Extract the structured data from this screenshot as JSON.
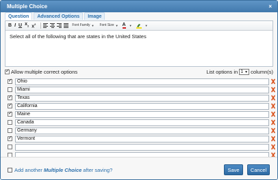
{
  "dialog": {
    "title": "Multiple Choice",
    "close_glyph": "×"
  },
  "tabs": [
    {
      "label": "Question",
      "active": true
    },
    {
      "label": "Advanced Options",
      "active": false
    },
    {
      "label": "Image",
      "active": false
    }
  ],
  "toolbar": {
    "bold": "B",
    "italic": "I",
    "underline": "U",
    "subscript": "x",
    "superscript": "x",
    "font_family": "Font Family",
    "font_size": "Font Size",
    "text_color_glyph": "A"
  },
  "editor": {
    "question_text": "Select all of the following that are states in the United States"
  },
  "options": {
    "allow_multiple_label": "Allow multiple correct options",
    "allow_multiple_checked": true,
    "list_options_prefix": "List options in",
    "columns_value": "1",
    "columns_suffix": "column(s)"
  },
  "choices": [
    {
      "text": "Ohio",
      "correct": true
    },
    {
      "text": "Miami",
      "correct": false
    },
    {
      "text": "Texas",
      "correct": true
    },
    {
      "text": "California",
      "correct": true
    },
    {
      "text": "Maine",
      "correct": true
    },
    {
      "text": "Canada",
      "correct": false
    },
    {
      "text": "Germany",
      "correct": false
    },
    {
      "text": "Vermont",
      "correct": true
    },
    {
      "text": "",
      "correct": false
    },
    {
      "text": "",
      "correct": false
    }
  ],
  "footer": {
    "add_prefix": "Add another",
    "add_emphasis": "Multiple Choice",
    "add_suffix": "after saving?",
    "save_label": "Save",
    "cancel_label": "Cancel"
  },
  "colors": {
    "title_bar": "#4a82b6",
    "button": "#3a78b3",
    "delete_icon": "#d9531e",
    "link": "#2b6fab"
  },
  "icons": {
    "delete": "x-delete-icon",
    "close": "close-icon"
  }
}
